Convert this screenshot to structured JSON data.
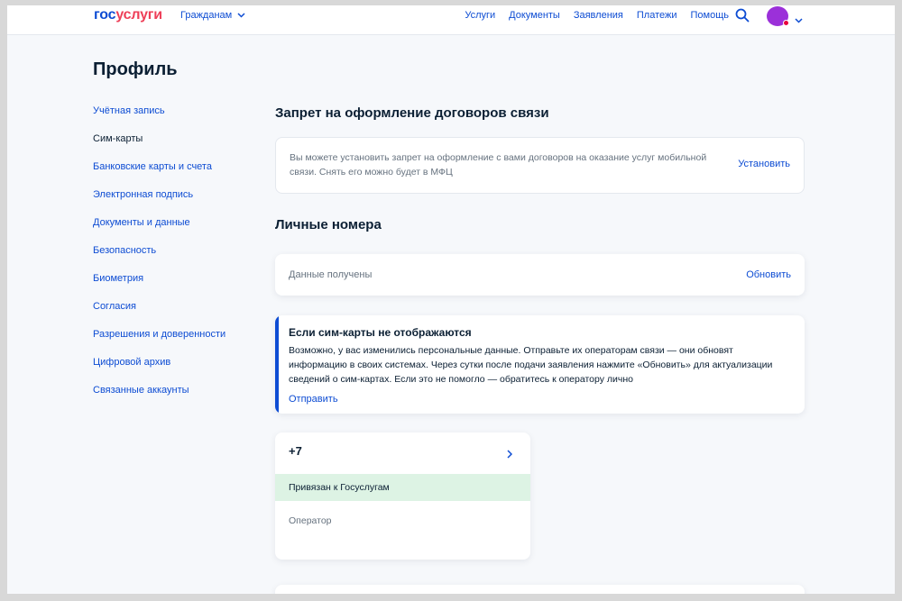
{
  "header": {
    "logo_part1": "гос",
    "logo_part2": "услуги",
    "audience_label": "Гражданам",
    "nav": [
      "Услуги",
      "Документы",
      "Заявления",
      "Платежи",
      "Помощь"
    ],
    "search_icon": "search-icon",
    "avatar_color": "#9b30d9",
    "notification_color": "#e8003d"
  },
  "page": {
    "title": "Профиль"
  },
  "sidebar": {
    "items": [
      {
        "label": "Учётная запись",
        "active": false
      },
      {
        "label": "Сим-карты",
        "active": true
      },
      {
        "label": "Банковские карты и счета",
        "active": false
      },
      {
        "label": "Электронная подпись",
        "active": false
      },
      {
        "label": "Документы и данные",
        "active": false
      },
      {
        "label": "Безопасность",
        "active": false
      },
      {
        "label": "Биометрия",
        "active": false
      },
      {
        "label": "Согласия",
        "active": false
      },
      {
        "label": "Разрешения и доверенности",
        "active": false
      },
      {
        "label": "Цифровой архив",
        "active": false
      },
      {
        "label": "Связанные аккаунты",
        "active": false
      }
    ]
  },
  "ban_section": {
    "heading": "Запрет на оформление договоров связи",
    "text": "Вы можете установить запрет на оформление с вами договоров на оказание услуг мобильной связи. Снять его можно будет в МФЦ",
    "action": "Установить"
  },
  "numbers_section": {
    "heading": "Личные номера",
    "status_text": "Данные получены",
    "refresh_action": "Обновить"
  },
  "info_card": {
    "title": "Если сим-карты не отображаются",
    "body": "Возможно, у вас изменились персональные данные. Отправьте их операторам связи — они обновят информацию в своих системах. Через сутки после подачи заявления нажмите «Обновить» для актуализации сведений о сим-картах. Если это не помогло — обратитесь к оператору лично",
    "action": "Отправить",
    "accent_color": "#0d4cd3"
  },
  "sim_card": {
    "number": "+7",
    "badge": "Привязан к Госуслугам",
    "badge_color": "#ddf3e4",
    "operator_label": "Оператор"
  },
  "colors": {
    "link": "#0d4cd3",
    "text": "#0b1f33",
    "muted": "#66727f",
    "background": "#f6f8fb"
  }
}
